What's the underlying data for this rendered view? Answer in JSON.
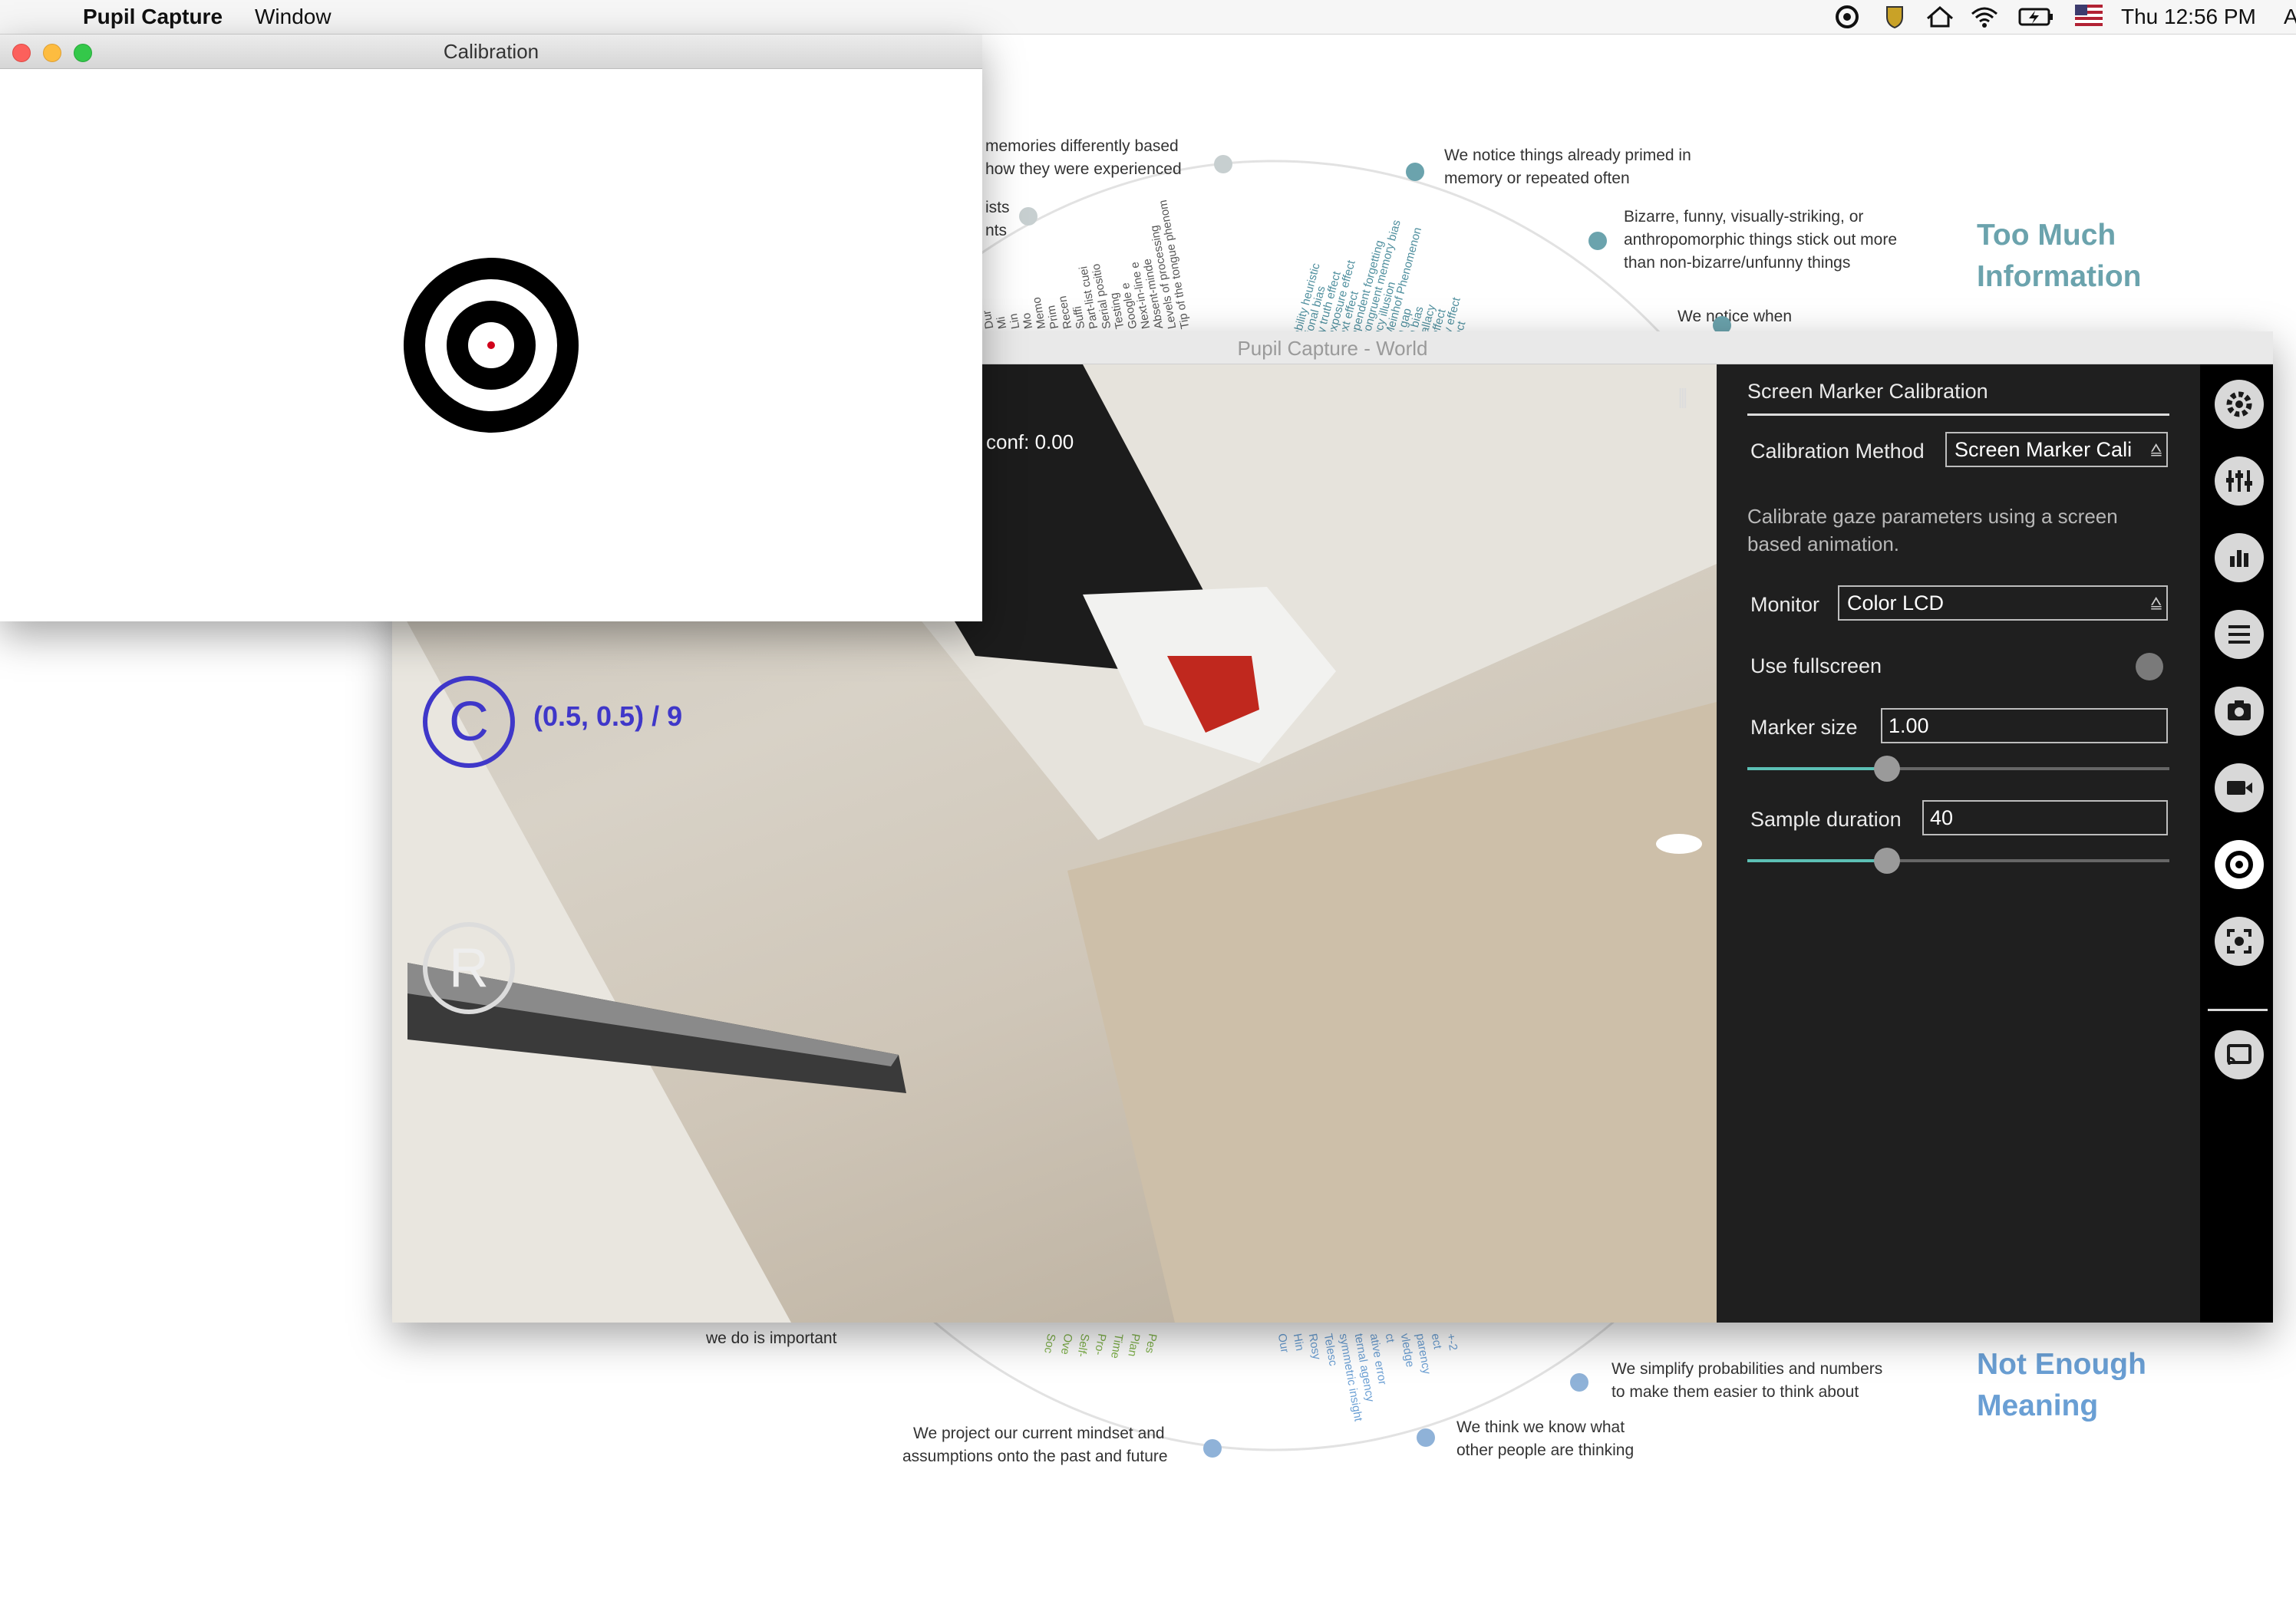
{
  "menubar": {
    "apple": "",
    "app_name": "Pupil Capture",
    "menu_window": "Window",
    "clock": "Thu 12:56 PM",
    "user": "A"
  },
  "background": {
    "texts_top": [
      "memories differently based",
      "how they were experienced",
      "ists",
      "nts",
      "We notice things already primed in",
      "memory or repeated often",
      "Bizarre, funny, visually-striking, or",
      "anthropomorphic things stick out more",
      "than non-bizarre/unfunny things",
      "We notice when"
    ],
    "heading_top": [
      "Too Much",
      "Information"
    ],
    "radial_top": [
      "Tip of the tongue phenom",
      "Levels of processing",
      "Absent-minde",
      "Next-in-line e",
      "Google e",
      "Testing",
      "Serial positio",
      "Part-list cuei",
      "Suffi",
      "Recen",
      "Prim",
      "Memo",
      "Mo",
      "Lin",
      "Mi",
      "Dur",
      "ability heuristic",
      "tional bias",
      "ry truth effect",
      "exposure effect",
      "ext effect",
      "ependent forgetting",
      "congruent memory bias",
      "ncy illusion",
      "Meinhof Phenomenon",
      "n gap",
      "n bias",
      "fallacy",
      "effect",
      "ty effect",
      "ect"
    ],
    "texts_bottom": [
      "we do is important",
      "We simplify probabilities and numbers",
      "to make them easier to think about",
      "We project our current mindset and",
      "assumptions onto the past and future",
      "We think we know what",
      "other people are thinking"
    ],
    "heading_bottom": [
      "Not Enough",
      "Meaning"
    ],
    "radial_bottom": [
      "Soc",
      "Ove",
      "Self-",
      "Pro-",
      "Time",
      "Plan",
      "Pes",
      "Our",
      "Hin",
      "Rosy",
      "Telesc",
      "symmetric insight",
      "ternal agency",
      "ative error",
      "ct",
      "vledge",
      "parency",
      "ect",
      "+-2"
    ]
  },
  "calibration_window": {
    "title": "Calibration"
  },
  "world_window": {
    "title": "Pupil Capture - World",
    "conf": "conf: 0.00",
    "drag_handle": "|||",
    "c_marker": "C",
    "c_marker_label": "(0.5, 0.5) / 9",
    "r_marker": "R"
  },
  "panel": {
    "title": "Screen Marker Calibration",
    "calibration_method_label": "Calibration Method",
    "calibration_method_value": "Screen Marker Cali",
    "description": "Calibrate gaze parameters using a screen based animation.",
    "monitor_label": "Monitor",
    "monitor_value": "Color LCD",
    "fullscreen_label": "Use fullscreen",
    "fullscreen_on": false,
    "marker_size_label": "Marker size",
    "marker_size_value": "1.00",
    "marker_size_slider_fraction": 0.33,
    "sample_duration_label": "Sample duration",
    "sample_duration_value": "40",
    "sample_duration_slider_fraction": 0.33
  },
  "iconbar": {
    "icons": [
      "gear-icon",
      "sliders-icon",
      "bar-chart-icon",
      "list-icon",
      "camera-icon",
      "video-icon",
      "calibration-target-icon",
      "capture-focus-icon",
      "cast-icon"
    ],
    "active_icon": "calibration-target-icon"
  },
  "colors": {
    "teal": "#4f8f9e",
    "blue": "#6a9fd4",
    "green": "#7fb24a",
    "c_marker": "#3f37c9",
    "slider": "#5cc0b5"
  }
}
